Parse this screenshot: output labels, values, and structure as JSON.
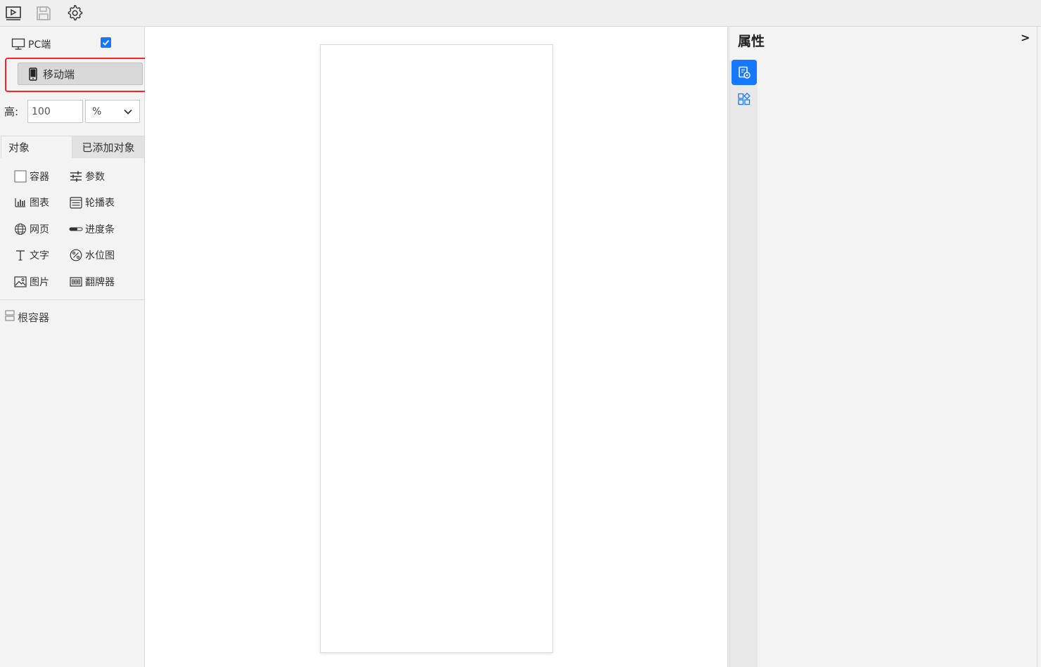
{
  "toolbar": {
    "icons": [
      "preview-icon",
      "save-icon",
      "settings-icon"
    ]
  },
  "left": {
    "pc_label": "PC端",
    "pc_checked": true,
    "mobile_label": "移动端",
    "height_label": "高:",
    "height_value": "100",
    "height_unit": "%",
    "tabs": {
      "objects": "对象",
      "added": "已添加对象"
    },
    "objects": {
      "container": "容器",
      "params": "参数",
      "chart": "图表",
      "carousel": "轮播表",
      "webpage": "网页",
      "progress": "进度条",
      "text": "文字",
      "water": "水位图",
      "image": "图片",
      "flip": "翻牌器"
    },
    "root_container": "根容器"
  },
  "right": {
    "title": "属性",
    "collapse": ">"
  },
  "colors": {
    "accent": "#1677ff",
    "highlight": "#ff2222"
  }
}
